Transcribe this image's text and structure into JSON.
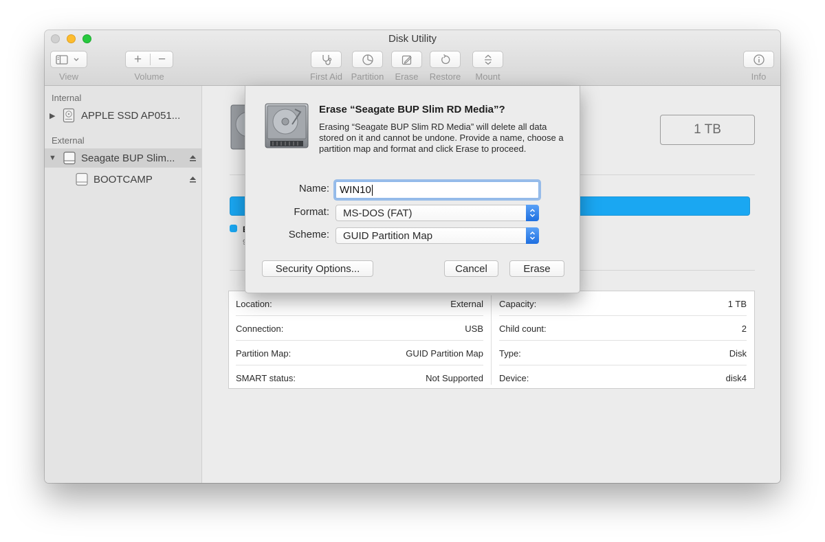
{
  "window": {
    "title": "Disk Utility"
  },
  "toolbar": {
    "view_label": "View",
    "volume_label": "Volume",
    "volume_add": "+",
    "volume_remove": "−",
    "first_aid_label": "First Aid",
    "partition_label": "Partition",
    "erase_label": "Erase",
    "restore_label": "Restore",
    "mount_label": "Mount",
    "info_label": "Info"
  },
  "sidebar": {
    "internal_header": "Internal",
    "external_header": "External",
    "items": [
      {
        "label": "APPLE SSD AP051...",
        "icon": "internal-disk-icon",
        "expanded": false,
        "selected": false
      },
      {
        "label": "Seagate BUP Slim...",
        "icon": "external-disk-icon",
        "expanded": true,
        "selected": true,
        "ejectable": true
      },
      {
        "label": "BOOTCAMP",
        "icon": "volume-icon",
        "selected": false,
        "ejectable": true
      }
    ]
  },
  "content": {
    "capacity": "1 TB",
    "legend_title": "E",
    "legend_sub": "9",
    "usage_color": "#1aa7f2",
    "info": {
      "left": [
        {
          "label": "Location:",
          "value": "External"
        },
        {
          "label": "Connection:",
          "value": "USB"
        },
        {
          "label": "Partition Map:",
          "value": "GUID Partition Map"
        },
        {
          "label": "SMART status:",
          "value": "Not Supported"
        }
      ],
      "right": [
        {
          "label": "Capacity:",
          "value": "1 TB"
        },
        {
          "label": "Child count:",
          "value": "2"
        },
        {
          "label": "Type:",
          "value": "Disk"
        },
        {
          "label": "Device:",
          "value": "disk4"
        }
      ]
    }
  },
  "sheet": {
    "title": "Erase “Seagate BUP Slim RD Media”?",
    "message": "Erasing “Seagate BUP Slim RD Media” will delete all data stored on it and cannot be undone. Provide a name, choose a partition map and format and click Erase to proceed.",
    "name_label": "Name:",
    "name_value": "WIN10",
    "format_label": "Format:",
    "format_value": "MS-DOS (FAT)",
    "scheme_label": "Scheme:",
    "scheme_value": "GUID Partition Map",
    "security_button": "Security Options...",
    "cancel_button": "Cancel",
    "erase_button": "Erase"
  }
}
